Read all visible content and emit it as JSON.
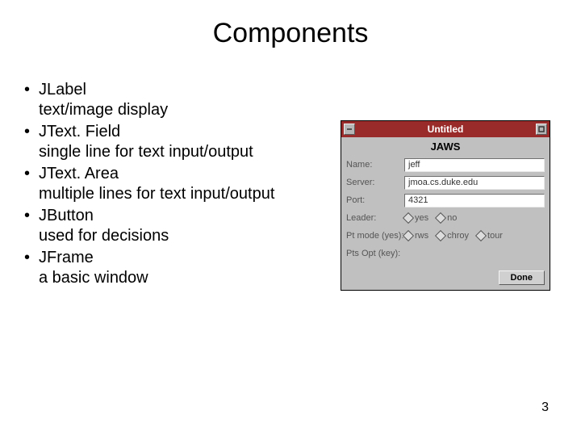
{
  "title": "Components",
  "page_number": "3",
  "bullets": [
    {
      "name": "JLabel",
      "desc": "text/image display"
    },
    {
      "name": "JText. Field",
      "desc": "single line for text input/output"
    },
    {
      "name": "JText. Area",
      "desc": "multiple lines for text input/output"
    },
    {
      "name": "JButton",
      "desc": "used for decisions"
    },
    {
      "name": "JFrame",
      "desc": "a basic window"
    }
  ],
  "example_window": {
    "titlebar": "Untitled",
    "app_name": "JAWS",
    "rows": {
      "name": {
        "label": "Name:",
        "value": "jeff"
      },
      "server": {
        "label": "Server:",
        "value": "jmoa.cs.duke.edu"
      },
      "port": {
        "label": "Port:",
        "value": "4321"
      },
      "leader": {
        "label": "Leader:",
        "options": [
          "yes",
          "no"
        ]
      },
      "mode": {
        "label": "Pt mode (yes):",
        "options": [
          "rws",
          "chroy",
          "tour"
        ]
      },
      "keys": {
        "label": "Pts Opt (key):",
        "options": []
      }
    },
    "done": "Done"
  }
}
